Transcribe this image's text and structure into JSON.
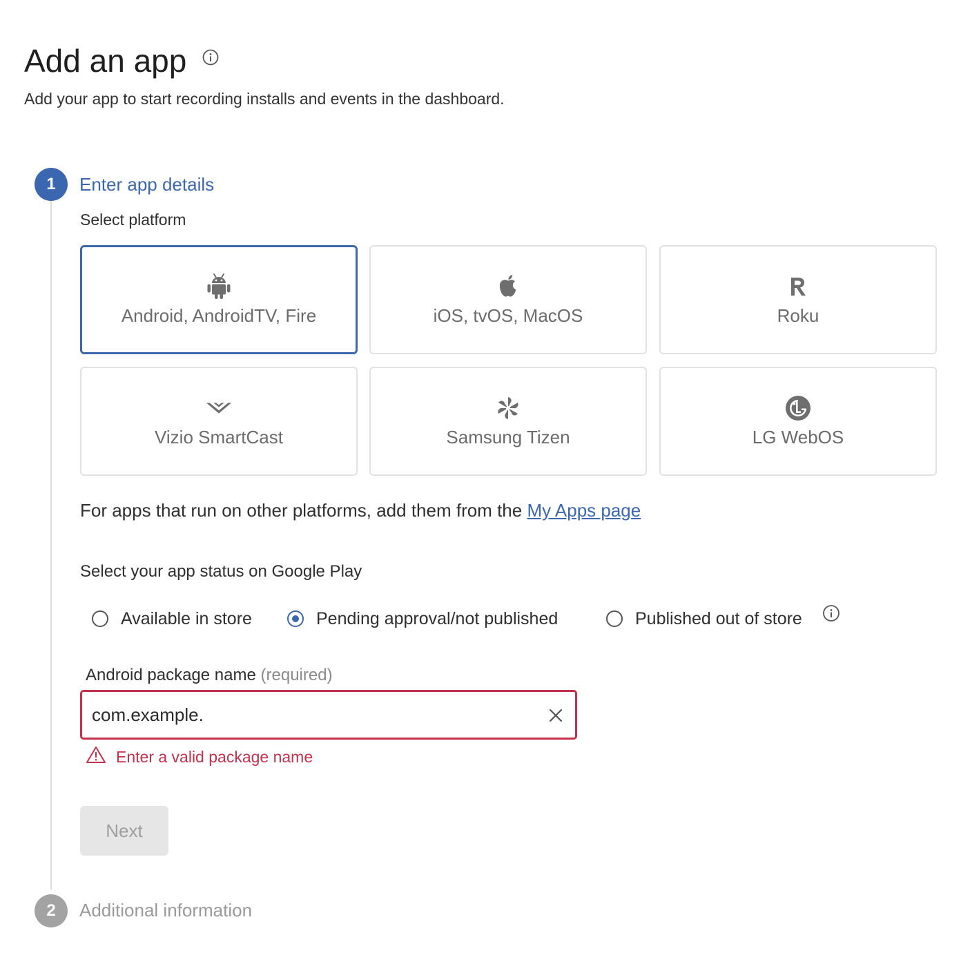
{
  "header": {
    "title": "Add an app",
    "subtitle": "Add your app to start recording installs and events in the dashboard."
  },
  "step1": {
    "number": "1",
    "title": "Enter app details",
    "select_platform_label": "Select platform",
    "platforms": [
      {
        "label": "Android, AndroidTV, Fire",
        "icon": "android-icon",
        "selected": true
      },
      {
        "label": "iOS, tvOS, MacOS",
        "icon": "apple-icon",
        "selected": false
      },
      {
        "label": "Roku",
        "icon": "roku-icon",
        "selected": false
      },
      {
        "label": "Vizio SmartCast",
        "icon": "vizio-icon",
        "selected": false
      },
      {
        "label": "Samsung Tizen",
        "icon": "tizen-icon",
        "selected": false
      },
      {
        "label": "LG WebOS",
        "icon": "lg-icon",
        "selected": false
      }
    ],
    "other_platforms_text": "For apps that run on other platforms, add them from the",
    "other_platforms_link": "My Apps page",
    "status_label": "Select your app status on Google Play",
    "status_options": [
      {
        "label": "Available in store",
        "checked": false
      },
      {
        "label": "Pending approval/not published",
        "checked": true
      },
      {
        "label": "Published out of store",
        "checked": false
      }
    ],
    "package_field": {
      "label": "Android package name",
      "required_label": "(required)",
      "value": "com.example.",
      "error": "Enter a valid package name"
    },
    "next_button": "Next"
  },
  "step2": {
    "number": "2",
    "title": "Additional information"
  },
  "colors": {
    "accent": "#3b67b0",
    "error": "#c4314b",
    "disabled_text": "#9e9e9e"
  }
}
